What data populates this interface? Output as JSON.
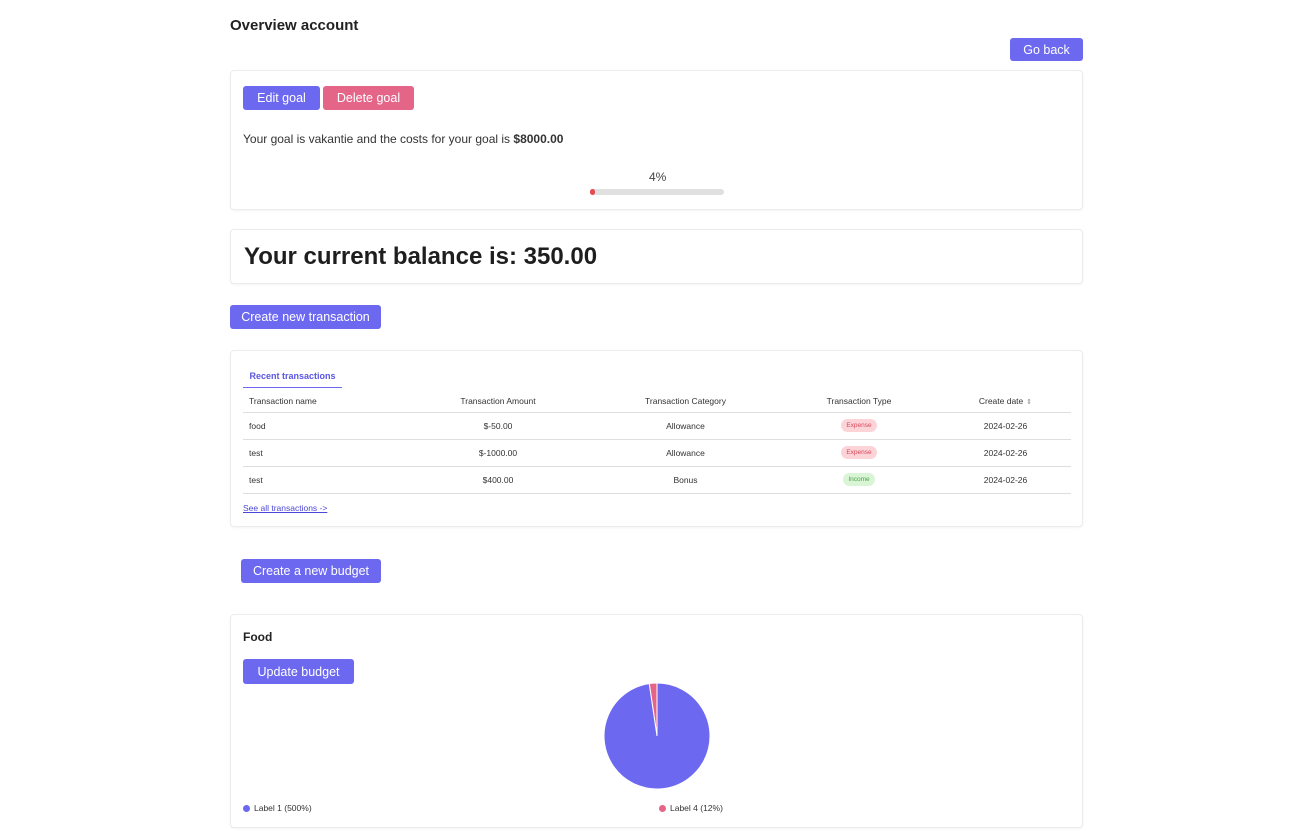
{
  "page": {
    "title": "Overview account",
    "go_back_label": "Go back"
  },
  "goal": {
    "edit_label": "Edit goal",
    "delete_label": "Delete goal",
    "text_prefix": "Your goal is vakantie and the costs for your goal is ",
    "cost": "$8000.00",
    "progress_percent": 4,
    "progress_label": "4%",
    "progress_color": "#e44b4b"
  },
  "balance": {
    "text": "Your current balance is: 350.00"
  },
  "transactions": {
    "create_label": "Create new transaction",
    "tab_label": "Recent transactions",
    "columns": [
      "Transaction name",
      "Transaction Amount",
      "Transaction Category",
      "Transaction Type",
      "Create date"
    ],
    "rows": [
      {
        "name": "food",
        "amount": "$-50.00",
        "category": "Allowance",
        "type": "Expense",
        "date": "2024-02-26"
      },
      {
        "name": "test",
        "amount": "$-1000.00",
        "category": "Allowance",
        "type": "Expense",
        "date": "2024-02-26"
      },
      {
        "name": "test",
        "amount": "$400.00",
        "category": "Bonus",
        "type": "Income",
        "date": "2024-02-26"
      }
    ],
    "see_all_label": "See all transactions ->"
  },
  "budget": {
    "create_label": "Create a new budget",
    "title": "Food",
    "update_label": "Update budget",
    "chart_data": {
      "type": "pie",
      "categories": [
        "Label 1",
        "Label 4"
      ],
      "values": [
        500,
        12
      ],
      "legend": [
        "Label 1 (500%)",
        "Label 4 (12%)"
      ],
      "colors": [
        "#6c68ef",
        "#e56589"
      ],
      "legend_position": "bottom"
    }
  },
  "colors": {
    "primary": "#6c68ef",
    "danger": "#e56589"
  }
}
